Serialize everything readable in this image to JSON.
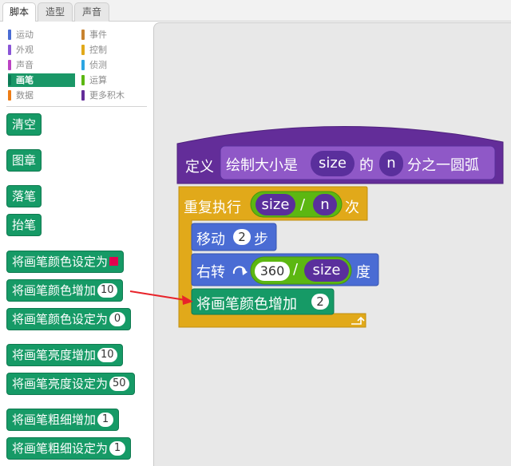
{
  "tabs": [
    "脚本",
    "造型",
    "声音"
  ],
  "categories": {
    "left": [
      {
        "label": "运动",
        "color": "#4a6cd4"
      },
      {
        "label": "外观",
        "color": "#8a55d7"
      },
      {
        "label": "声音",
        "color": "#bb42c3"
      },
      {
        "label": "画笔",
        "color": "#0e9a6c"
      },
      {
        "label": "数据",
        "color": "#ee7d16"
      }
    ],
    "right": [
      {
        "label": "事件",
        "color": "#c88330"
      },
      {
        "label": "控制",
        "color": "#e1a91a"
      },
      {
        "label": "侦测",
        "color": "#2ca5e2"
      },
      {
        "label": "运算",
        "color": "#5cb712"
      },
      {
        "label": "更多积木",
        "color": "#632d99"
      }
    ]
  },
  "palette_blocks": [
    {
      "label": "清空",
      "value": ""
    },
    {
      "label": "图章",
      "value": ""
    },
    {
      "label": "落笔",
      "value": ""
    },
    {
      "label": "抬笔",
      "value": ""
    },
    {
      "label": "将画笔颜色设定为",
      "value": ""
    },
    {
      "label": "将画笔颜色增加",
      "value": "10"
    },
    {
      "label": "将画笔颜色设定为",
      "value": "0"
    },
    {
      "label": "将画笔亮度增加",
      "value": "10"
    },
    {
      "label": "将画笔亮度设定为",
      "value": "50"
    },
    {
      "label": "将画笔粗细增加",
      "value": "1"
    },
    {
      "label": "将画笔粗细设定为",
      "value": "1"
    }
  ],
  "script": {
    "define": {
      "keyword": "定义",
      "text1": "绘制大小是",
      "param1": "size",
      "text2": "的",
      "param2": "n",
      "text3": "分之一圆弧"
    },
    "repeat": {
      "label": "重复执行",
      "left": "size",
      "op": "/",
      "right": "n",
      "suffix": "次"
    },
    "move": {
      "label": "移动",
      "value": "2",
      "suffix": "步"
    },
    "turn": {
      "label": "右转",
      "icon": "rotate-clockwise-icon",
      "left": "360",
      "op": "/",
      "right": "size",
      "suffix": "度"
    },
    "pen_color": {
      "label": "将画笔颜色增加",
      "value": "2"
    },
    "loop_end_icon": "loop-arrow-icon"
  },
  "colors": {
    "pen": "#169a66",
    "more_blocks": "#632d99",
    "control": "#e1a91a",
    "motion": "#4a6cd4",
    "operator": "#5cb712",
    "arrow": "#e8232a"
  }
}
